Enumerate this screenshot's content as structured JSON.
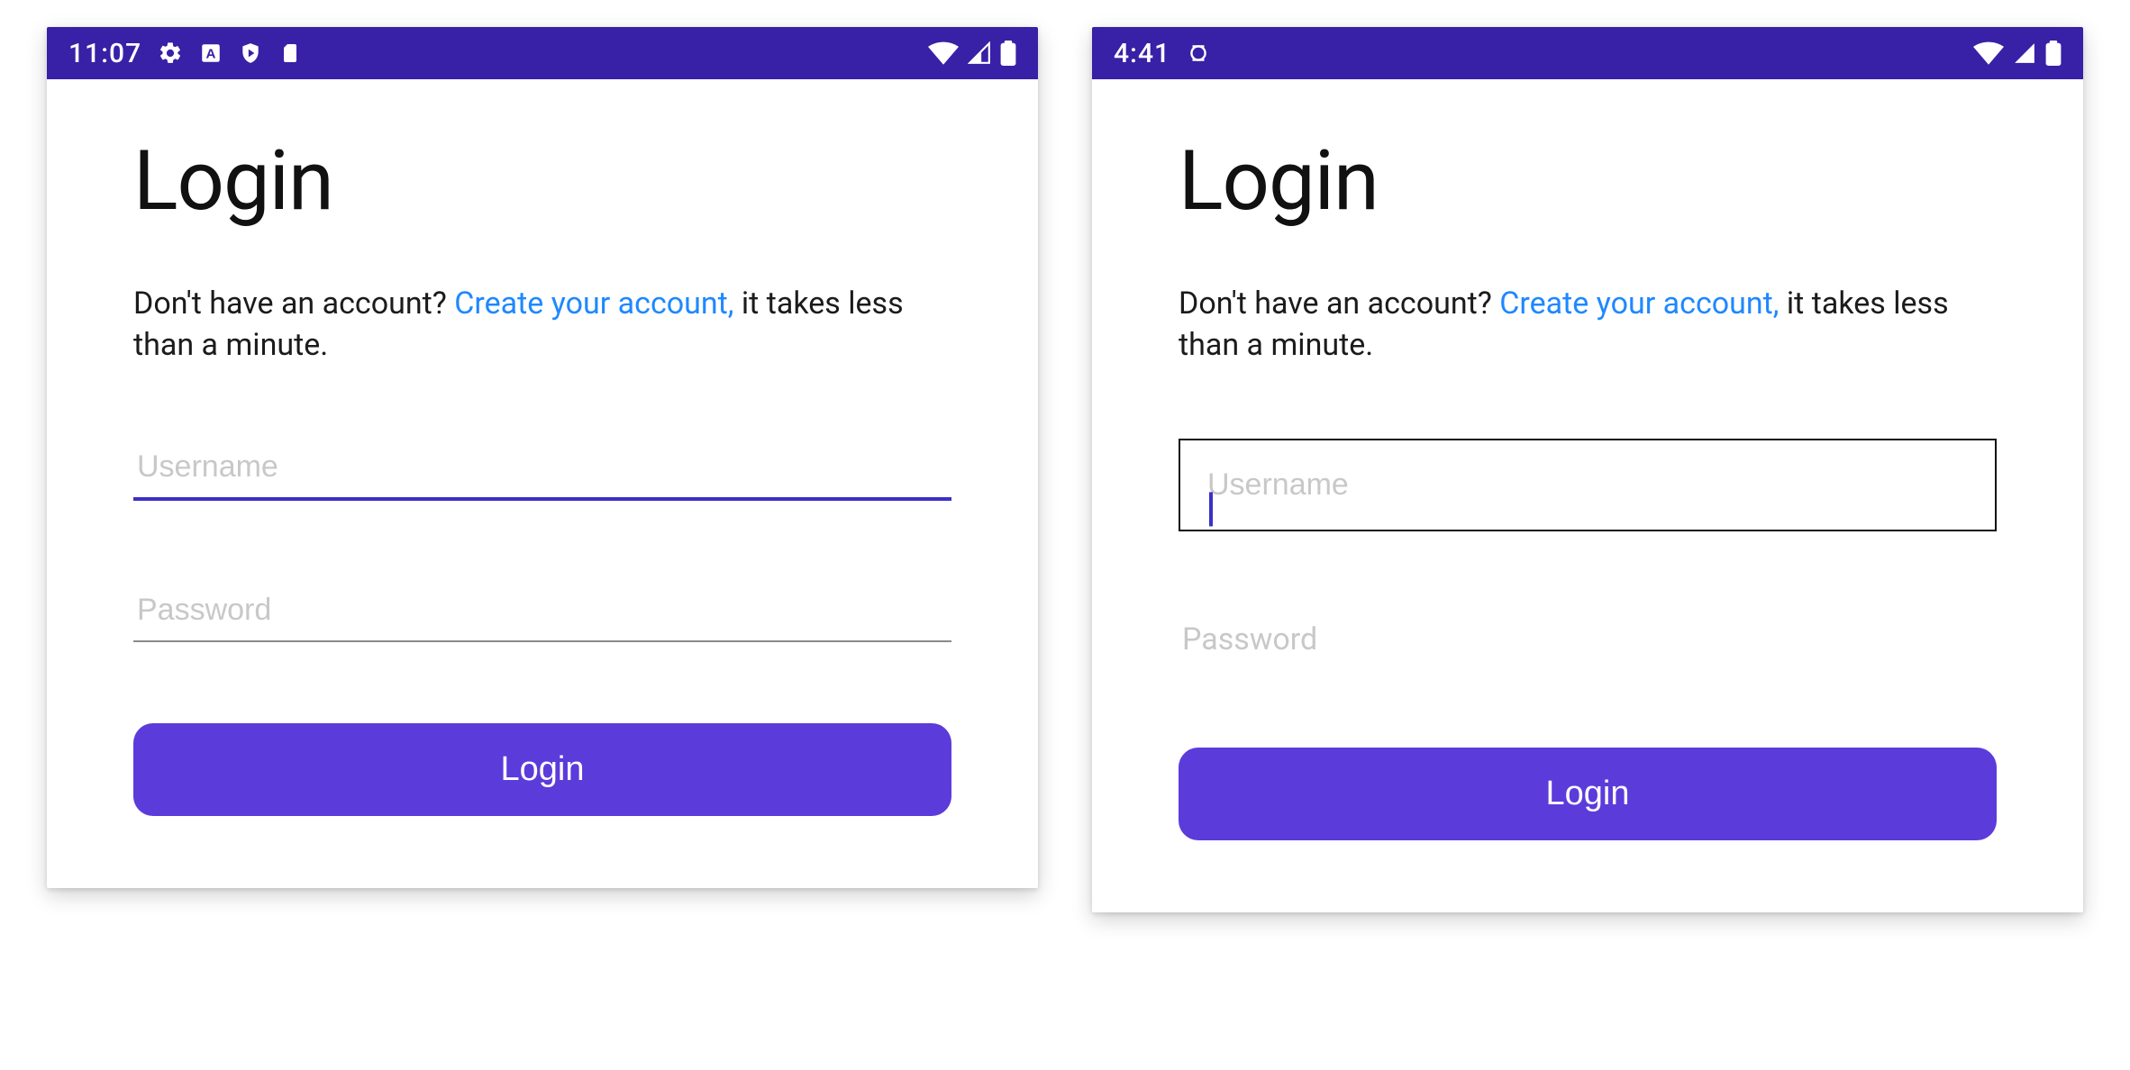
{
  "colors": {
    "statusbar": "#3820A7",
    "button": "#5C3BDB",
    "accent_underline": "#3C2FC7",
    "link": "#1E88FF"
  },
  "left": {
    "statusbar": {
      "time": "11:07"
    },
    "title": "Login",
    "subtitle_pre": "Don't have an account? ",
    "subtitle_link": "Create your account,",
    "subtitle_post": " it takes less than a minute.",
    "username_placeholder": "Username",
    "password_placeholder": "Password",
    "button_label": "Login"
  },
  "right": {
    "statusbar": {
      "time": "4:41"
    },
    "title": "Login",
    "subtitle_pre": "Don't have an account? ",
    "subtitle_link": "Create your account,",
    "subtitle_post": " it takes less than a minute.",
    "username_placeholder": "Username",
    "password_placeholder": "Password",
    "button_label": "Login"
  }
}
